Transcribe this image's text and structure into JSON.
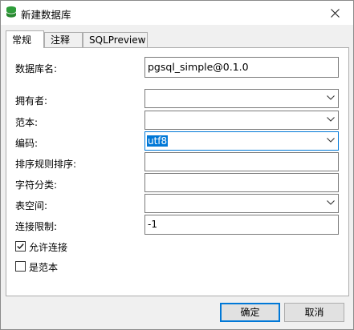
{
  "window": {
    "title": "新建数据库"
  },
  "tabs": [
    {
      "label": "常规"
    },
    {
      "label": "注释"
    },
    {
      "label": "SQLPreview"
    }
  ],
  "form": {
    "db_name_label": "数据库名:",
    "db_name_value": "pgsql_simple@0.1.0",
    "owner_label": "拥有者:",
    "owner_value": "",
    "template_label": "范本:",
    "template_value": "",
    "encoding_label": "编码:",
    "encoding_value": "utf8",
    "collation_label": "排序规则排序:",
    "collation_value": "",
    "ctype_label": "字符分类:",
    "ctype_value": "",
    "tablespace_label": "表空间:",
    "tablespace_value": "",
    "conn_limit_label": "连接限制:",
    "conn_limit_value": "-1",
    "allow_conn_label": "允许连接",
    "allow_conn_checked": true,
    "is_template_label": "是范本",
    "is_template_checked": false
  },
  "buttons": {
    "ok": "确定",
    "cancel": "取消"
  }
}
